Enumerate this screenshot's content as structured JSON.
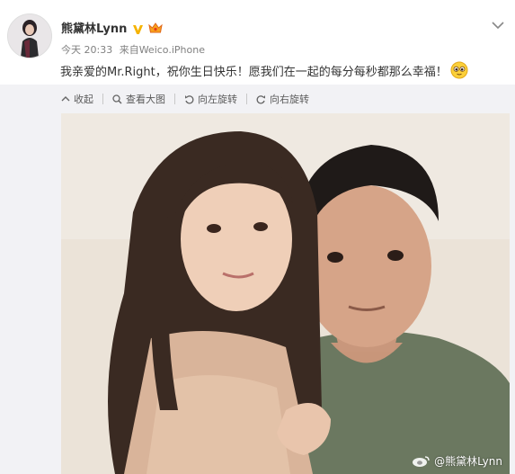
{
  "post": {
    "username": "熊黛林Lynn",
    "time": "今天 20:33",
    "source_prefix": "来自",
    "source": "Weico.iPhone",
    "text": "我亲爱的Mr.Right，祝你生日快乐！愿我们在一起的每分每秒都那么幸福！"
  },
  "toolbar": {
    "collapse": "收起",
    "view_large": "查看大图",
    "rotate_left": "向左旋转",
    "rotate_right": "向右旋转"
  },
  "image": {
    "watermark": "@熊黛林Lynn"
  },
  "icons": {
    "verified": "verified-v-icon",
    "member": "crown-member-icon",
    "menu": "chevron-down-icon",
    "emoji": "adore-emoji-icon"
  },
  "colors": {
    "verified": "#f5b300",
    "link": "#eb7350",
    "muted": "#808080",
    "panel": "#f2f2f5"
  }
}
